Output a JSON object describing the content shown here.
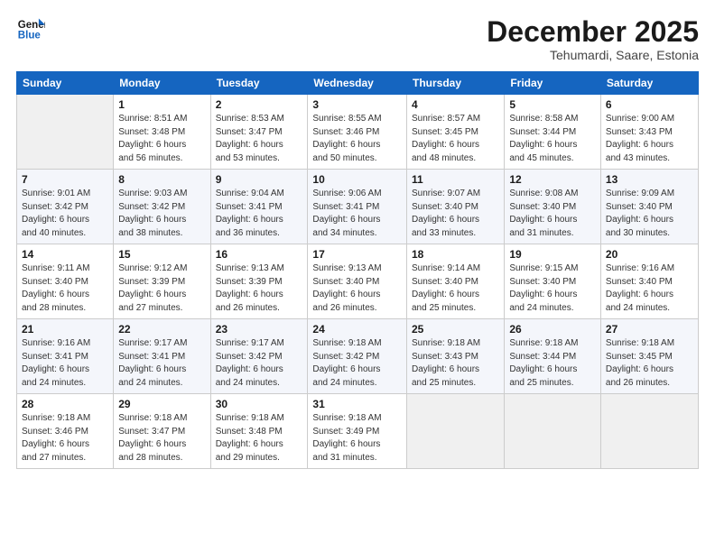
{
  "logo": {
    "line1": "General",
    "line2": "Blue"
  },
  "title": "December 2025",
  "subtitle": "Tehumardi, Saare, Estonia",
  "days_of_week": [
    "Sunday",
    "Monday",
    "Tuesday",
    "Wednesday",
    "Thursday",
    "Friday",
    "Saturday"
  ],
  "weeks": [
    [
      {
        "num": "",
        "empty": true
      },
      {
        "num": "1",
        "sunrise": "Sunrise: 8:51 AM",
        "sunset": "Sunset: 3:48 PM",
        "daylight": "Daylight: 6 hours and 56 minutes."
      },
      {
        "num": "2",
        "sunrise": "Sunrise: 8:53 AM",
        "sunset": "Sunset: 3:47 PM",
        "daylight": "Daylight: 6 hours and 53 minutes."
      },
      {
        "num": "3",
        "sunrise": "Sunrise: 8:55 AM",
        "sunset": "Sunset: 3:46 PM",
        "daylight": "Daylight: 6 hours and 50 minutes."
      },
      {
        "num": "4",
        "sunrise": "Sunrise: 8:57 AM",
        "sunset": "Sunset: 3:45 PM",
        "daylight": "Daylight: 6 hours and 48 minutes."
      },
      {
        "num": "5",
        "sunrise": "Sunrise: 8:58 AM",
        "sunset": "Sunset: 3:44 PM",
        "daylight": "Daylight: 6 hours and 45 minutes."
      },
      {
        "num": "6",
        "sunrise": "Sunrise: 9:00 AM",
        "sunset": "Sunset: 3:43 PM",
        "daylight": "Daylight: 6 hours and 43 minutes."
      }
    ],
    [
      {
        "num": "7",
        "sunrise": "Sunrise: 9:01 AM",
        "sunset": "Sunset: 3:42 PM",
        "daylight": "Daylight: 6 hours and 40 minutes."
      },
      {
        "num": "8",
        "sunrise": "Sunrise: 9:03 AM",
        "sunset": "Sunset: 3:42 PM",
        "daylight": "Daylight: 6 hours and 38 minutes."
      },
      {
        "num": "9",
        "sunrise": "Sunrise: 9:04 AM",
        "sunset": "Sunset: 3:41 PM",
        "daylight": "Daylight: 6 hours and 36 minutes."
      },
      {
        "num": "10",
        "sunrise": "Sunrise: 9:06 AM",
        "sunset": "Sunset: 3:41 PM",
        "daylight": "Daylight: 6 hours and 34 minutes."
      },
      {
        "num": "11",
        "sunrise": "Sunrise: 9:07 AM",
        "sunset": "Sunset: 3:40 PM",
        "daylight": "Daylight: 6 hours and 33 minutes."
      },
      {
        "num": "12",
        "sunrise": "Sunrise: 9:08 AM",
        "sunset": "Sunset: 3:40 PM",
        "daylight": "Daylight: 6 hours and 31 minutes."
      },
      {
        "num": "13",
        "sunrise": "Sunrise: 9:09 AM",
        "sunset": "Sunset: 3:40 PM",
        "daylight": "Daylight: 6 hours and 30 minutes."
      }
    ],
    [
      {
        "num": "14",
        "sunrise": "Sunrise: 9:11 AM",
        "sunset": "Sunset: 3:40 PM",
        "daylight": "Daylight: 6 hours and 28 minutes."
      },
      {
        "num": "15",
        "sunrise": "Sunrise: 9:12 AM",
        "sunset": "Sunset: 3:39 PM",
        "daylight": "Daylight: 6 hours and 27 minutes."
      },
      {
        "num": "16",
        "sunrise": "Sunrise: 9:13 AM",
        "sunset": "Sunset: 3:39 PM",
        "daylight": "Daylight: 6 hours and 26 minutes."
      },
      {
        "num": "17",
        "sunrise": "Sunrise: 9:13 AM",
        "sunset": "Sunset: 3:40 PM",
        "daylight": "Daylight: 6 hours and 26 minutes."
      },
      {
        "num": "18",
        "sunrise": "Sunrise: 9:14 AM",
        "sunset": "Sunset: 3:40 PM",
        "daylight": "Daylight: 6 hours and 25 minutes."
      },
      {
        "num": "19",
        "sunrise": "Sunrise: 9:15 AM",
        "sunset": "Sunset: 3:40 PM",
        "daylight": "Daylight: 6 hours and 24 minutes."
      },
      {
        "num": "20",
        "sunrise": "Sunrise: 9:16 AM",
        "sunset": "Sunset: 3:40 PM",
        "daylight": "Daylight: 6 hours and 24 minutes."
      }
    ],
    [
      {
        "num": "21",
        "sunrise": "Sunrise: 9:16 AM",
        "sunset": "Sunset: 3:41 PM",
        "daylight": "Daylight: 6 hours and 24 minutes."
      },
      {
        "num": "22",
        "sunrise": "Sunrise: 9:17 AM",
        "sunset": "Sunset: 3:41 PM",
        "daylight": "Daylight: 6 hours and 24 minutes."
      },
      {
        "num": "23",
        "sunrise": "Sunrise: 9:17 AM",
        "sunset": "Sunset: 3:42 PM",
        "daylight": "Daylight: 6 hours and 24 minutes."
      },
      {
        "num": "24",
        "sunrise": "Sunrise: 9:18 AM",
        "sunset": "Sunset: 3:42 PM",
        "daylight": "Daylight: 6 hours and 24 minutes."
      },
      {
        "num": "25",
        "sunrise": "Sunrise: 9:18 AM",
        "sunset": "Sunset: 3:43 PM",
        "daylight": "Daylight: 6 hours and 25 minutes."
      },
      {
        "num": "26",
        "sunrise": "Sunrise: 9:18 AM",
        "sunset": "Sunset: 3:44 PM",
        "daylight": "Daylight: 6 hours and 25 minutes."
      },
      {
        "num": "27",
        "sunrise": "Sunrise: 9:18 AM",
        "sunset": "Sunset: 3:45 PM",
        "daylight": "Daylight: 6 hours and 26 minutes."
      }
    ],
    [
      {
        "num": "28",
        "sunrise": "Sunrise: 9:18 AM",
        "sunset": "Sunset: 3:46 PM",
        "daylight": "Daylight: 6 hours and 27 minutes."
      },
      {
        "num": "29",
        "sunrise": "Sunrise: 9:18 AM",
        "sunset": "Sunset: 3:47 PM",
        "daylight": "Daylight: 6 hours and 28 minutes."
      },
      {
        "num": "30",
        "sunrise": "Sunrise: 9:18 AM",
        "sunset": "Sunset: 3:48 PM",
        "daylight": "Daylight: 6 hours and 29 minutes."
      },
      {
        "num": "31",
        "sunrise": "Sunrise: 9:18 AM",
        "sunset": "Sunset: 3:49 PM",
        "daylight": "Daylight: 6 hours and 31 minutes."
      },
      {
        "num": "",
        "empty": true
      },
      {
        "num": "",
        "empty": true
      },
      {
        "num": "",
        "empty": true
      }
    ]
  ]
}
